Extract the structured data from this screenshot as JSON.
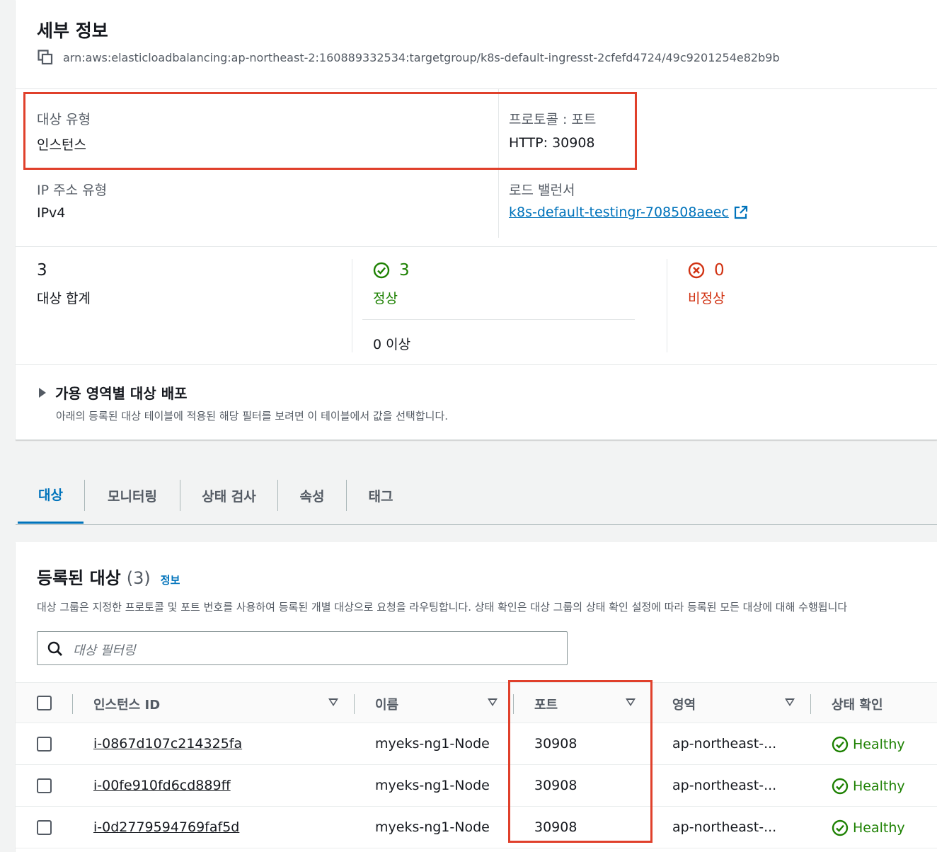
{
  "details": {
    "title": "세부 정보",
    "arn": "arn:aws:elasticloadbalancing:ap-northeast-2:160889332534:targetgroup/k8s-default-ingresst-2cfefd4724/49c9201254e82b9b",
    "target_type_label": "대상 유형",
    "target_type_value": "인스턴스",
    "protocol_port_label": "프로토콜 : 포트",
    "protocol_port_value": "HTTP: 30908",
    "ip_type_label": "IP 주소 유형",
    "ip_type_value": "IPv4",
    "lb_label": "로드 밸런서",
    "lb_value": "k8s-default-testingr-708508aeec"
  },
  "summary": {
    "total_value": "3",
    "total_label": "대상 합계",
    "healthy_value": "3",
    "healthy_label": "정상",
    "anomaly_label": "0 이상",
    "unhealthy_value": "0",
    "unhealthy_label": "비정상"
  },
  "az": {
    "title": "가용 영역별 대상 배포",
    "description": "아래의 등록된 대상 테이블에 적용된 해당 필터를 보려면 이 테이블에서 값을 선택합니다."
  },
  "tabs": [
    "대상",
    "모니터링",
    "상태 검사",
    "속성",
    "태그"
  ],
  "targets": {
    "title": "등록된 대상",
    "count": "(3)",
    "info_link": "정보",
    "description": "대상 그룹은 지정한 프로토콜 및 포트 번호를 사용하여 등록된 개별 대상으로 요청을 라우팅합니다. 상태 확인은 대상 그룹의 상태 확인 설정에 따라 등록된 모든 대상에 대해 수행됩니다",
    "filter_placeholder": "대상 필터링",
    "columns": [
      "인스턴스 ID",
      "이름",
      "포트",
      "영역",
      "상태 확인"
    ],
    "rows": [
      {
        "id": "i-0867d107c214325fa",
        "name": "myeks-ng1-Node",
        "port": "30908",
        "zone": "ap-northeast-...",
        "health": "Healthy"
      },
      {
        "id": "i-00fe910fd6cd889ff",
        "name": "myeks-ng1-Node",
        "port": "30908",
        "zone": "ap-northeast-...",
        "health": "Healthy"
      },
      {
        "id": "i-0d2779594769faf5d",
        "name": "myeks-ng1-Node",
        "port": "30908",
        "zone": "ap-northeast-...",
        "health": "Healthy"
      }
    ]
  },
  "colors": {
    "link": "#0073bb",
    "healthy": "#1d8102",
    "unhealthy": "#d13212",
    "highlight": "#e0402b"
  }
}
